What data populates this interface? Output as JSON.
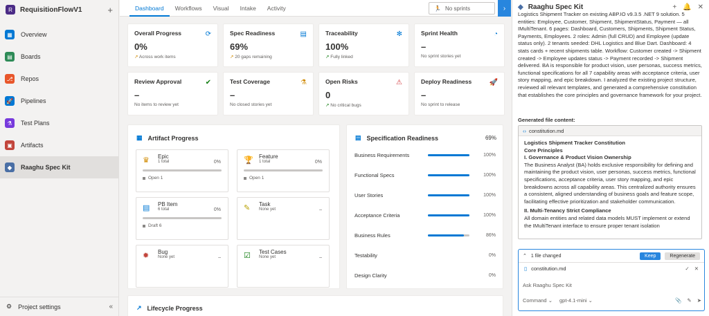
{
  "project": {
    "badge": "R",
    "name": "RequisitionFlowV1",
    "add": "+"
  },
  "nav": [
    {
      "label": "Overview",
      "icon": "overview-icon",
      "color": "#0078d4",
      "glyph": "▦"
    },
    {
      "label": "Boards",
      "icon": "boards-icon",
      "color": "#2e8b57",
      "glyph": "▤"
    },
    {
      "label": "Repos",
      "icon": "repos-icon",
      "color": "#e8562a",
      "glyph": "⎇"
    },
    {
      "label": "Pipelines",
      "icon": "pipelines-icon",
      "color": "#0078d4",
      "glyph": "🚀"
    },
    {
      "label": "Test Plans",
      "icon": "test-plans-icon",
      "color": "#773adc",
      "glyph": "⚗"
    },
    {
      "label": "Artifacts",
      "icon": "artifacts-icon",
      "color": "#c2453b",
      "glyph": "▣"
    },
    {
      "label": "Raaghu Spec Kit",
      "icon": "raaghu-spec-kit-icon",
      "color": "#4a6fa5",
      "glyph": "◆"
    }
  ],
  "settings": {
    "label": "Project settings",
    "collapse": "«"
  },
  "tabs": [
    "Dashboard",
    "Workflows",
    "Visual",
    "Intake",
    "Activity"
  ],
  "sprint": {
    "label": "No sprints"
  },
  "cards": [
    {
      "title": "Overall Progress",
      "value": "0%",
      "sub": "Across work items",
      "icon": "refresh-icon",
      "glyph": "⟳",
      "color": "#0078d4",
      "subGlyph": "↗",
      "subColor": "#d08a00"
    },
    {
      "title": "Spec Readiness",
      "value": "69%",
      "sub": "20 gaps remaining",
      "icon": "document-icon",
      "glyph": "▤",
      "color": "#0078d4",
      "subGlyph": "↗",
      "subColor": "#d08a00"
    },
    {
      "title": "Traceability",
      "value": "100%",
      "sub": "Fully linked",
      "icon": "network-icon",
      "glyph": "✻",
      "color": "#0078d4",
      "subGlyph": "↗",
      "subColor": "#107c10"
    },
    {
      "title": "Sprint Health",
      "value": "–",
      "sub": "No sprint stories yet",
      "icon": "gauge-icon",
      "glyph": "◔",
      "color": "#0078d4",
      "subGlyph": "",
      "subColor": "#605e5c"
    },
    {
      "title": "Review Approval",
      "value": "–",
      "sub": "No items to review yet",
      "icon": "check-circle-icon",
      "glyph": "✔",
      "color": "#107c10",
      "subGlyph": "",
      "subColor": "#605e5c"
    },
    {
      "title": "Test Coverage",
      "value": "–",
      "sub": "No closed stories yet",
      "icon": "flask-icon",
      "glyph": "⚗",
      "color": "#d08a00",
      "subGlyph": "",
      "subColor": "#605e5c"
    },
    {
      "title": "Open Risks",
      "value": "0",
      "sub": "No critical bugs",
      "icon": "warning-icon",
      "glyph": "⚠",
      "color": "#d13438",
      "subGlyph": "↗",
      "subColor": "#107c10"
    },
    {
      "title": "Deploy Readiness",
      "value": "–",
      "sub": "No sprint to release",
      "icon": "rocket-icon",
      "glyph": "🚀",
      "color": "#107c10",
      "subGlyph": "",
      "subColor": "#605e5c"
    }
  ],
  "artifact": {
    "title": "Artifact Progress",
    "items": [
      {
        "name": "Epic",
        "sub": "1 total",
        "pct": "0%",
        "status": "Open 1",
        "icon": "crown-icon",
        "glyph": "♛",
        "color": "#d08a00",
        "progress": 0
      },
      {
        "name": "Feature",
        "sub": "1 total",
        "pct": "0%",
        "status": "Open 1",
        "icon": "trophy-icon",
        "glyph": "🏆",
        "color": "#773adc",
        "progress": 0
      },
      {
        "name": "PB Item",
        "sub": "6 total",
        "pct": "0%",
        "status": "Draft 6",
        "icon": "pb-item-icon",
        "glyph": "▤",
        "color": "#0078d4",
        "progress": 0
      },
      {
        "name": "Task",
        "sub": "None yet",
        "pct": "–",
        "status": "",
        "icon": "task-icon",
        "glyph": "✎",
        "color": "#b8a000",
        "progress": null
      },
      {
        "name": "Bug",
        "sub": "None yet",
        "pct": "–",
        "status": "",
        "icon": "bug-icon",
        "glyph": "✹",
        "color": "#c2453b",
        "progress": null
      },
      {
        "name": "Test Cases",
        "sub": "None yet",
        "pct": "–",
        "status": "",
        "icon": "test-cases-icon",
        "glyph": "☑",
        "color": "#107c10",
        "progress": null
      }
    ]
  },
  "spec": {
    "title": "Specification Readiness",
    "value": "69%",
    "rows": [
      {
        "label": "Business Requirements",
        "pct": "100%",
        "value": 100
      },
      {
        "label": "Functional Specs",
        "pct": "100%",
        "value": 100
      },
      {
        "label": "User Stories",
        "pct": "100%",
        "value": 100
      },
      {
        "label": "Acceptance Criteria",
        "pct": "100%",
        "value": 100
      },
      {
        "label": "Business Rules",
        "pct": "86%",
        "value": 86
      },
      {
        "label": "Testability",
        "pct": "0%",
        "value": 0
      },
      {
        "label": "Design Clarity",
        "pct": "0%",
        "value": 0
      }
    ]
  },
  "lifecycle": {
    "title": "Lifecycle Progress"
  },
  "assistant": {
    "title": "Raaghu Spec Kit",
    "add": "+",
    "bell": "🔔",
    "close": "✕",
    "message": "Logistics Shipment Tracker on existing ABP.IO v9.3.5 .NET 9 solution. 5 entities: Employee, Customer, Shipment, ShipmentStatus, Payment — all IMultiTenant. 6 pages: Dashboard, Customers, Shipments, Shipment Status, Payments, Employees. 2 roles: Admin (full CRUD) and Employee (update status only). 2 tenants seeded: DHL Logistics and Blue Dart. Dashboard: 4 stats cards + recent shipments table. Workflow: Customer created -> Shipment created -> Employee updates status -> Payment recorded -> Shipment delivered. BA is responsible for product vision, user personas, success metrics, functional specifications for all 7 capability areas with acceptance criteria, user story mapping, and epic breakdown. I analyzed the existing project structure, reviewed all relevant templates, and generated a comprehensive constitution that establishes the core principles and governance framework for your project.",
    "generated_label": "Generated file content:",
    "file_name": "constitution.md",
    "doc_title": "Logistics Shipment Tracker Constitution",
    "doc_sub": "Core Principles",
    "sec1": "I. Governance & Product Vision Ownership",
    "sec1_text": "The Business Analyst (BA) holds exclusive responsibility for defining and maintaining the product vision, user personas, success metrics, functional specifications, acceptance criteria, user story mapping, and epic breakdowns across all capability areas. This centralized authority ensures a consistent, aligned understanding of business goals and feature scope, facilitating effective prioritization and stakeholder communication.",
    "sec2": "II. Multi-Tenancy Strict Compliance",
    "sec2_text": "All domain entities and related data models MUST implement or extend the IMultiTenant interface to ensure proper tenant isolation",
    "changed": "1 file changed",
    "keep": "Keep",
    "regenerate": "Regenerate",
    "changed_file": "constitution.md",
    "ask": "Ask Raaghu Spec Kit",
    "mode": "Command",
    "model": "gpt-4.1-mini"
  }
}
